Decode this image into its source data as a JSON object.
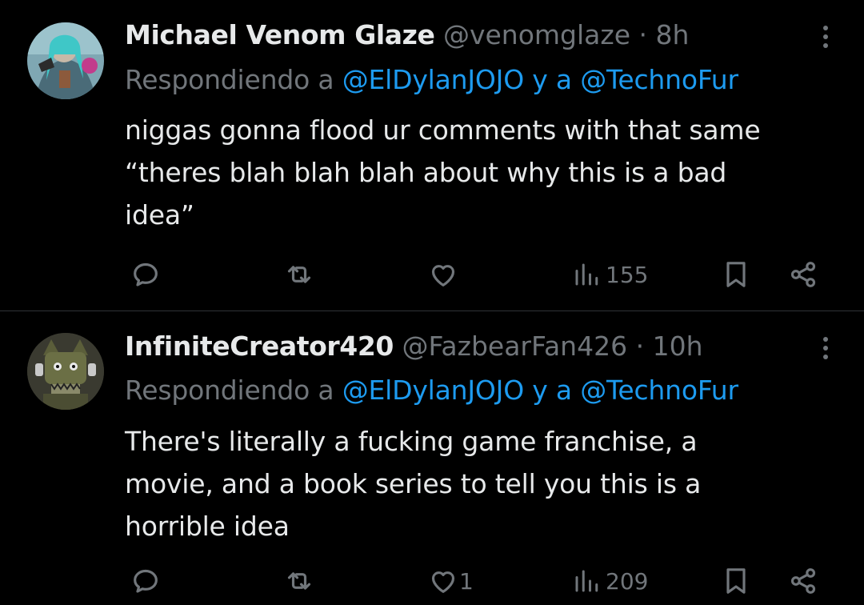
{
  "tweets": [
    {
      "display_name": "Michael Venom Glaze",
      "handle": "@venomglaze",
      "separator": "·",
      "time": "8h",
      "replying_prefix": "Respondiendo a",
      "mention_1": "@ElDylanJOJO",
      "replying_joiner": "y a",
      "mention_2": "@TechnoFur",
      "text_lines": [
        "niggas gonna flood ur comments with that same",
        "“theres blah blah blah about why this is a bad",
        "idea”"
      ],
      "reply_count": "",
      "retweet_count": "",
      "like_count": "",
      "view_count": "155"
    },
    {
      "display_name": "InfiniteCreator420",
      "handle": "@FazbearFan426",
      "separator": "·",
      "time": "10h",
      "replying_prefix": "Respondiendo a",
      "mention_1": "@ElDylanJOJO",
      "replying_joiner": "y a",
      "mention_2": "@TechnoFur",
      "text_lines": [
        "There's literally a fucking game franchise, a",
        "movie, and a book series to tell you this is a",
        "horrible idea"
      ],
      "reply_count": "",
      "retweet_count": "",
      "like_count": "1",
      "view_count": "209"
    }
  ],
  "icons": {
    "reply": "reply-icon",
    "retweet": "retweet-icon",
    "like": "heart-icon",
    "views": "views-icon",
    "bookmark": "bookmark-icon",
    "share": "share-icon",
    "more": "more-options-icon"
  },
  "colors": {
    "background": "#000000",
    "text_primary": "#e7e9ea",
    "text_secondary": "#71767b",
    "accent": "#1d9bf0",
    "divider": "#2f3336"
  }
}
